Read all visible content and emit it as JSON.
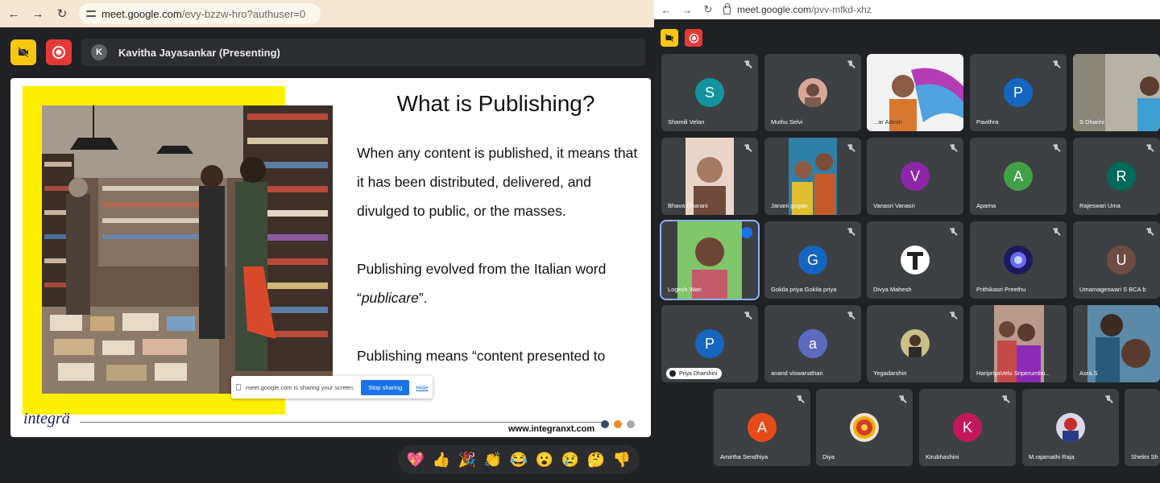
{
  "left": {
    "url_host": "meet.google.com",
    "url_path": "/evy-bzzw-hro?authuser=0",
    "presenter_initial": "K",
    "presenter_label": "Kavitha Jayasankar (Presenting)",
    "slide": {
      "title": "What is Publishing?",
      "para1": "When any content is published, it means that it has been distributed,  delivered, and divulged to public, or the masses.",
      "para2_a": "Publishing evolved from the Italian word “",
      "para2_b": "publicare",
      "para2_c": "”.",
      "para3": "Publishing means “content presented to",
      "brand_a": "integ",
      "brand_b": "rä",
      "site": "www.integranxt.com"
    },
    "share_bar": {
      "message": "meet.google.com is sharing your screen.",
      "stop_label": "Stop sharing",
      "hide_label": "Hide"
    },
    "reactions": [
      "💖",
      "👍",
      "🎉",
      "👏",
      "😂",
      "😮",
      "😢",
      "🤔",
      "👎"
    ]
  },
  "right": {
    "url_host": "meet.google.com",
    "url_path": "/pvv-mfkd-xhz",
    "participants": {
      "shamili": {
        "name": "Shamili Velan",
        "initial": "S",
        "color": "#12939f"
      },
      "muthu": {
        "name": "Muthu Selvi"
      },
      "admin": {
        "name": "...ar Admin"
      },
      "pavithra": {
        "name": "Pavithra",
        "initial": "P",
        "color": "#1565c0"
      },
      "dharini": {
        "name": "S Dharini"
      },
      "bhava": {
        "name": "Bhava Dharani"
      },
      "janani": {
        "name": "Janani gugan"
      },
      "vanasri": {
        "name": "Vanasri Vanasri",
        "initial": "V",
        "color": "#8e24aa"
      },
      "aparna": {
        "name": "Aparna",
        "initial": "A",
        "color": "#43a047"
      },
      "rajeswari": {
        "name": "Rajeswari Uma",
        "initial": "R",
        "color": "#00695c"
      },
      "logesh": {
        "name": "Logesh Wari"
      },
      "gokila": {
        "name": "Gokila priya Gokila priya",
        "initial": "G",
        "color": "#1565c0"
      },
      "divya_m": {
        "name": "Divya Mahesh"
      },
      "prithikasri": {
        "name": "Prithikasri Preethu"
      },
      "umamageswari": {
        "name": "Umamageswari S BCA b",
        "initial": "U",
        "color": "#6d4c41"
      },
      "priya": {
        "name": "Priya Dharshini",
        "initial": "P",
        "color": "#1565c0"
      },
      "anand": {
        "name": "anand viswanathan",
        "initial": "a",
        "color": "#5c6bc0"
      },
      "yegadarshin": {
        "name": "Yegadarshin"
      },
      "haripriya": {
        "name": "HaripriyaVelu Sriperumbu..."
      },
      "asra": {
        "name": "Asra.S"
      },
      "amirtha": {
        "name": "Amirtha Sendhiya",
        "initial": "A",
        "color": "#e64a19"
      },
      "diya": {
        "name": "Diya"
      },
      "kirubhashini": {
        "name": "Kirubhashini",
        "initial": "K",
        "color": "#c2185b"
      },
      "rajamathi": {
        "name": "M.rajamathi Raja"
      },
      "shelini": {
        "name": "Shelini Sh"
      }
    }
  },
  "colors": {
    "accent_blue": "#1a73e8",
    "meet_yellow": "#f9c80e",
    "meet_red": "#e53935"
  }
}
